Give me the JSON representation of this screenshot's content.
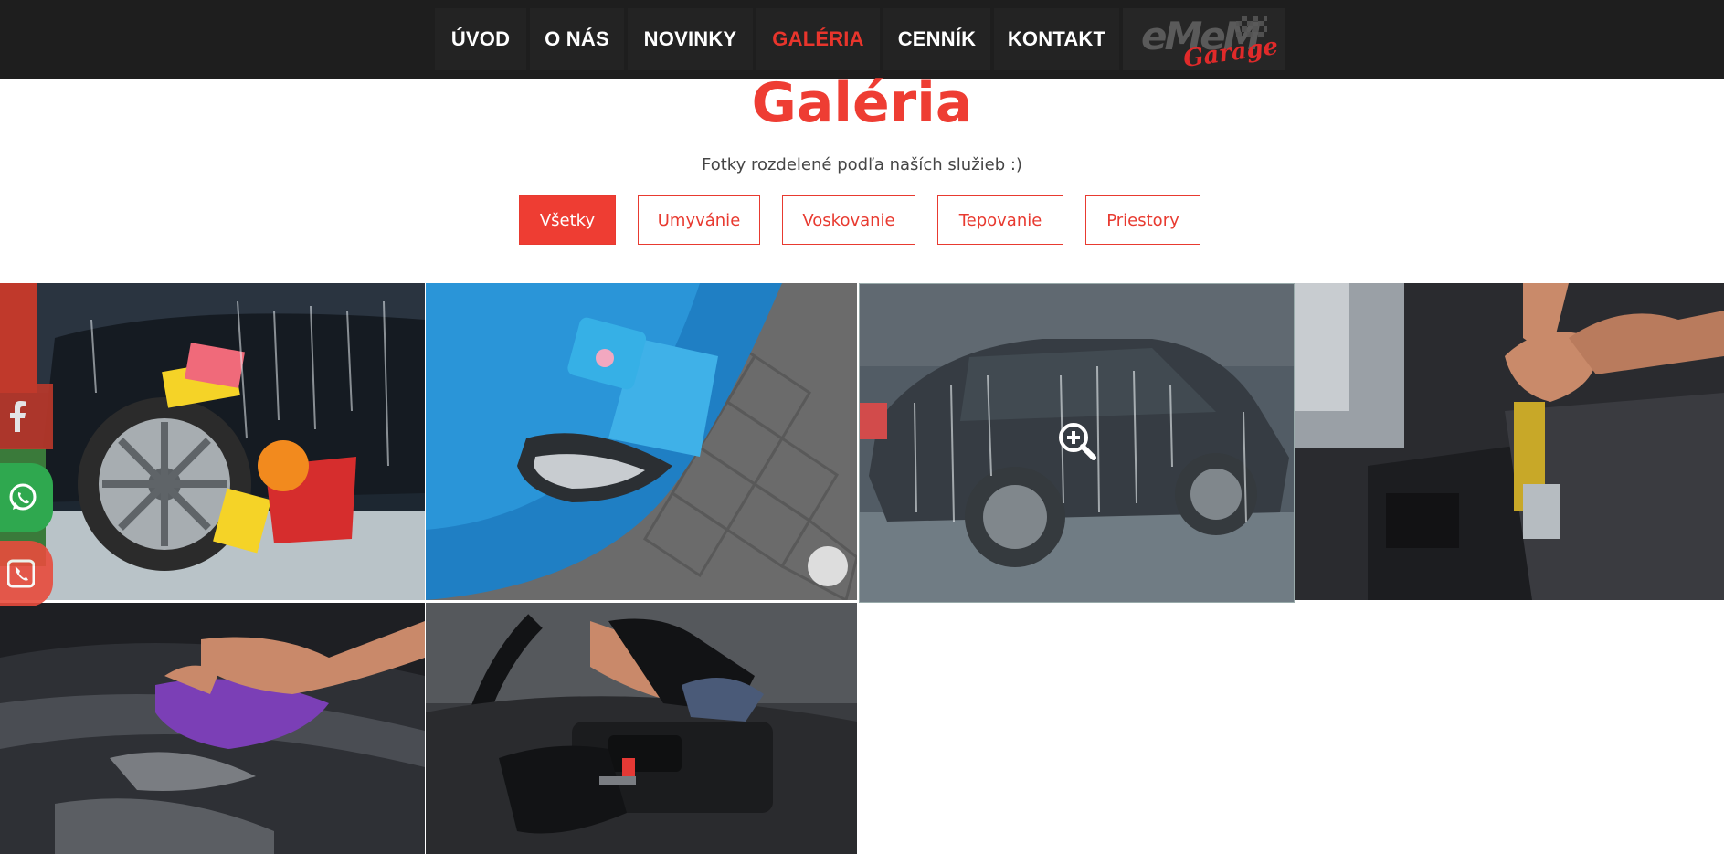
{
  "nav": {
    "items": [
      {
        "label": "ÚVOD",
        "active": false
      },
      {
        "label": "O NÁS",
        "active": false
      },
      {
        "label": "NOVINKY",
        "active": false
      },
      {
        "label": "GALÉRIA",
        "active": true
      },
      {
        "label": "CENNÍK",
        "active": false
      },
      {
        "label": "KONTAKT",
        "active": false
      }
    ],
    "logo": {
      "text": "eMeM",
      "sub": "Garage"
    }
  },
  "page": {
    "title": "Galéria",
    "subtitle": "Fotky rozdelené podľa naších služieb :)"
  },
  "filters": [
    {
      "label": "Všetky",
      "active": true
    },
    {
      "label": "Umyvánie",
      "active": false
    },
    {
      "label": "Voskovanie",
      "active": false
    },
    {
      "label": "Tepovanie",
      "active": false
    },
    {
      "label": "Priestory",
      "active": false
    }
  ],
  "gallery": {
    "zoom_icon": "zoom-in-icon",
    "tiles": [
      {
        "subject": "car-wheel-wash",
        "icon": "photo"
      },
      {
        "subject": "blue-car-hood-towel",
        "icon": "photo"
      },
      {
        "subject": "foamed-sedan",
        "icon": "photo"
      },
      {
        "subject": "interior-vacuum",
        "icon": "photo"
      },
      {
        "subject": "hood-polish",
        "icon": "photo"
      },
      {
        "subject": "dashboard-cleaning",
        "icon": "photo"
      }
    ]
  },
  "social": [
    {
      "icon": "facebook-icon",
      "color": "#c0392b"
    },
    {
      "icon": "whatsapp-icon",
      "color": "#25a244"
    },
    {
      "icon": "phone-icon",
      "color": "#e74c3c"
    }
  ],
  "colors": {
    "accent": "#ee3d33",
    "nav_bg": "#1e1e1e"
  }
}
